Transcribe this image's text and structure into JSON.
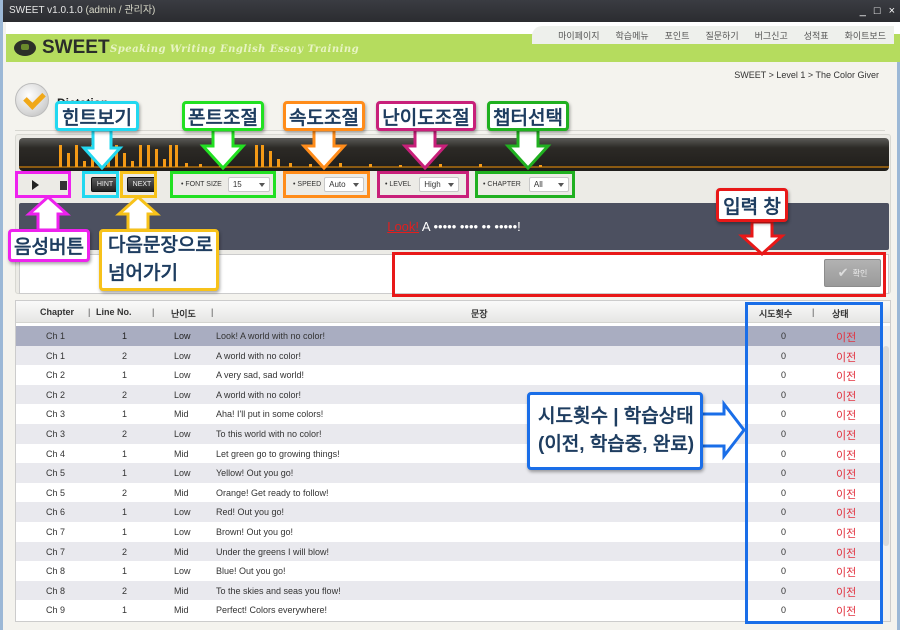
{
  "window": {
    "title": "SWEET v1.0.1.0",
    "user": "(admin / 관리자)",
    "controls": [
      "_",
      "□",
      "×"
    ]
  },
  "brand": {
    "name": "SWEET",
    "tagline": "Speaking Writing English Essay Training"
  },
  "nav": {
    "items": [
      "마이페이지",
      "학습메뉴",
      "포인트",
      "질문하기",
      "버그신고",
      "성적표",
      "화이트보드"
    ]
  },
  "breadcrumb": "SWEET > Level 1 > The Color Giver",
  "section": {
    "title": "Dictation",
    "icon": "check-icon"
  },
  "waveform": {
    "color": "#f49a16"
  },
  "controls": {
    "play_icon": "play-icon",
    "stop_icon": "stop-icon",
    "hint_label": "HINT",
    "next_label": "NEXT",
    "font_size": {
      "label": "FONT SIZE",
      "value": "15"
    },
    "speed": {
      "label": "SPEED",
      "value": "Auto"
    },
    "level": {
      "label": "LEVEL",
      "value": "High"
    },
    "chapter": {
      "label": "CHAPTER",
      "value": "All"
    }
  },
  "sentence": {
    "hint_word": "Look!",
    "masked": " A ••••• •••• •• •••••!"
  },
  "answer": {
    "value": "",
    "confirm_label": "확인"
  },
  "table": {
    "headers": {
      "chapter": "Chapter",
      "line": "Line No.",
      "level": "난이도",
      "sentence": "문장",
      "tries": "시도횟수",
      "status": "상태"
    },
    "rows": [
      {
        "chapter": "Ch 1",
        "line": "1",
        "level": "Low",
        "sentence": "Look! A world with no color!",
        "tries": "0",
        "status": "이전",
        "selected": true
      },
      {
        "chapter": "Ch 1",
        "line": "2",
        "level": "Low",
        "sentence": "A world with no color!",
        "tries": "0",
        "status": "이전"
      },
      {
        "chapter": "Ch 2",
        "line": "1",
        "level": "Low",
        "sentence": "A very sad, sad world!",
        "tries": "0",
        "status": "이전"
      },
      {
        "chapter": "Ch 2",
        "line": "2",
        "level": "Low",
        "sentence": "A world with no color!",
        "tries": "0",
        "status": "이전"
      },
      {
        "chapter": "Ch 3",
        "line": "1",
        "level": "Mid",
        "sentence": "Aha! I'll put in some colors!",
        "tries": "0",
        "status": "이전"
      },
      {
        "chapter": "Ch 3",
        "line": "2",
        "level": "Low",
        "sentence": "To this world with no color!",
        "tries": "0",
        "status": "이전"
      },
      {
        "chapter": "Ch 4",
        "line": "1",
        "level": "Mid",
        "sentence": "Let green go to growing things!",
        "tries": "0",
        "status": "이전"
      },
      {
        "chapter": "Ch 5",
        "line": "1",
        "level": "Low",
        "sentence": "Yellow! Out you go!",
        "tries": "0",
        "status": "이전"
      },
      {
        "chapter": "Ch 5",
        "line": "2",
        "level": "Mid",
        "sentence": "Orange! Get ready to follow!",
        "tries": "0",
        "status": "이전"
      },
      {
        "chapter": "Ch 6",
        "line": "1",
        "level": "Low",
        "sentence": "Red! Out you go!",
        "tries": "0",
        "status": "이전"
      },
      {
        "chapter": "Ch 7",
        "line": "1",
        "level": "Low",
        "sentence": "Brown! Out you go!",
        "tries": "0",
        "status": "이전"
      },
      {
        "chapter": "Ch 7",
        "line": "2",
        "level": "Mid",
        "sentence": "Under the greens I will blow!",
        "tries": "0",
        "status": "이전"
      },
      {
        "chapter": "Ch 8",
        "line": "1",
        "level": "Low",
        "sentence": "Blue! Out you go!",
        "tries": "0",
        "status": "이전"
      },
      {
        "chapter": "Ch 8",
        "line": "2",
        "level": "Mid",
        "sentence": "To the skies and seas you flow!",
        "tries": "0",
        "status": "이전"
      },
      {
        "chapter": "Ch 9",
        "line": "1",
        "level": "Mid",
        "sentence": "Perfect! Colors everywhere!",
        "tries": "0",
        "status": "이전"
      }
    ]
  },
  "annotations": {
    "hint": {
      "text": "힌트보기",
      "color": "#22d8f0"
    },
    "font": {
      "text": "폰트조절",
      "color": "#22e022"
    },
    "speed": {
      "text": "속도조절",
      "color": "#ff8c1a"
    },
    "level": {
      "text": "난이도조절",
      "color": "#c8207a"
    },
    "chapter": {
      "text": "챕터선택",
      "color": "#20b020"
    },
    "voice": {
      "text": "음성버튼",
      "color": "#ee22ee"
    },
    "next": {
      "line1": "다음문장으로",
      "line2": "넘어가기",
      "color": "#f7c21a"
    },
    "input": {
      "text": "입력 창",
      "color": "#e81818"
    },
    "status": {
      "line1": "시도횟수 | 학습상태",
      "line2": "(이전, 학습중, 완료)",
      "color": "#1a6ee8"
    }
  }
}
